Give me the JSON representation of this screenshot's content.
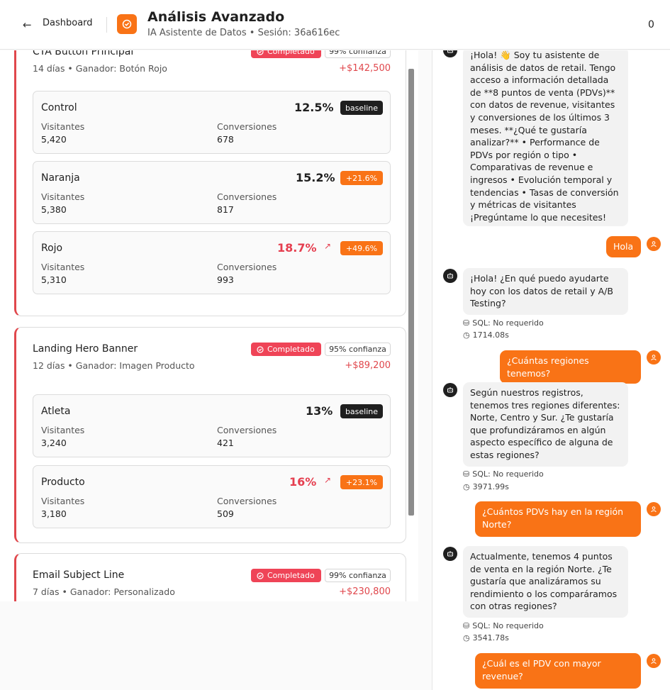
{
  "header": {
    "back_label": "Dashboard",
    "title": "Análisis Avanzado",
    "subtitle": "IA Asistente de Datos • Sesión: 36a616ec",
    "count": "0"
  },
  "tests": [
    {
      "title": "CTA Button Principal",
      "meta": "14 días • Ganador: Botón Rojo",
      "status": "Completado",
      "confidence": "99% confianza",
      "revenue": "+$142,500",
      "variants": [
        {
          "name": "Control",
          "rate": "12.5%",
          "pill": "baseline",
          "visitors_label": "Visitantes",
          "visitors": "5,420",
          "conversions_label": "Conversiones",
          "conversions": "678"
        },
        {
          "name": "Naranja",
          "rate": "15.2%",
          "pill": "+21.6%",
          "visitors_label": "Visitantes",
          "visitors": "5,380",
          "conversions_label": "Conversiones",
          "conversions": "817"
        },
        {
          "name": "Rojo",
          "rate": "18.7%",
          "pill": "+49.6%",
          "visitors_label": "Visitantes",
          "visitors": "5,310",
          "conversions_label": "Conversiones",
          "conversions": "993"
        }
      ]
    },
    {
      "title": "Landing Hero Banner",
      "meta": "12 días • Ganador: Imagen Producto",
      "status": "Completado",
      "confidence": "95% confianza",
      "revenue": "+$89,200",
      "variants": [
        {
          "name": "Atleta",
          "rate": "13%",
          "pill": "baseline",
          "visitors_label": "Visitantes",
          "visitors": "3,240",
          "conversions_label": "Conversiones",
          "conversions": "421"
        },
        {
          "name": "Producto",
          "rate": "16%",
          "pill": "+23.1%",
          "visitors_label": "Visitantes",
          "visitors": "3,180",
          "conversions_label": "Conversiones",
          "conversions": "509"
        }
      ]
    },
    {
      "title": "Email Subject Line",
      "meta": "7 días • Ganador: Personalizado",
      "status": "Completado",
      "confidence": "99% confianza",
      "revenue": "+$230,800"
    }
  ],
  "chat": {
    "m1": "¡Hola! 👋 Soy tu asistente de análisis de datos de retail. Tengo acceso a información detallada de **8 puntos de venta (PDVs)** con datos de revenue, visitantes y conversiones de los últimos 3 meses. **¿Qué te gustaría analizar?** • Performance de PDVs por región o tipo • Comparativas de revenue e ingresos • Evolución temporal y tendencias • Tasas de conversión y métricas de visitantes ¡Pregúntame lo que necesites!",
    "u1": "Hola",
    "m2": "¡Hola! ¿En qué puedo ayudarte hoy con los datos de retail y A/B Testing?",
    "m2_sql": "SQL: No requerido",
    "m2_time": "1714.08s",
    "u2": "¿Cuántas regiones tenemos?",
    "m3": "Según nuestros registros, tenemos tres regiones diferentes: Norte, Centro y Sur. ¿Te gustaría que profundizáramos en algún aspecto específico de alguna de estas regiones?",
    "m3_sql": "SQL: No requerido",
    "m3_time": "3971.99s",
    "u3": "¿Cuántos PDVs hay en la región Norte?",
    "m4": "Actualmente, tenemos 4 puntos de venta en la región Norte. ¿Te gustaría que analizáramos su rendimiento o los comparáramos con otras regiones?",
    "m4_sql": "SQL: No requerido",
    "m4_time": "3541.78s",
    "u4": "¿Cuál es el PDV con mayor revenue?"
  }
}
